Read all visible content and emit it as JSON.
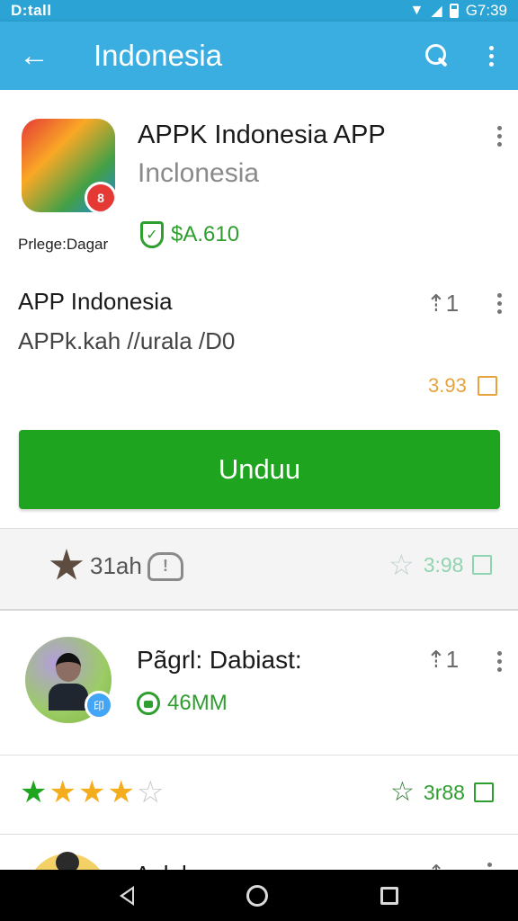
{
  "status_bar": {
    "left_text": "D:tall",
    "time": "G7:39"
  },
  "app_bar": {
    "title": "Indonesia"
  },
  "main_app": {
    "name": "APPK Indonesia APP",
    "subtitle": "Inclonesia",
    "developer_caption": "Prlege:Dagar",
    "price": "$A.610",
    "badge_text": "8"
  },
  "section": {
    "title": "APP Indonesia",
    "subtitle": "APPk.kah //urala /D0",
    "thumb_count": "1",
    "rating_value": "3.93"
  },
  "install_button": {
    "label": "Unduu",
    "color": "#1fa41f"
  },
  "stats_strip": {
    "left_text": "31ah",
    "right_value": "3:98"
  },
  "second_app": {
    "name": "Pãgrl: Dabiast:",
    "meta": "46MM",
    "thumb_count": "1",
    "badge_text": "印"
  },
  "ratings_row": {
    "stars_filled_green": 1,
    "stars_filled_gold": 3,
    "stars_empty": 1,
    "value": "3r88"
  },
  "peek_item": {
    "title": "Ank k"
  },
  "colors": {
    "app_bar": "#3aaee0",
    "status_bar": "#2ba3d4",
    "accent_green": "#1fa41f"
  },
  "icons": [
    "back-arrow-icon",
    "search-icon",
    "more-vert-icon",
    "shield-check-icon",
    "thumb-icon",
    "star-icon",
    "cloud-alert-icon",
    "checkbox-icon",
    "nav-back-icon",
    "nav-home-icon",
    "nav-recent-icon"
  ]
}
